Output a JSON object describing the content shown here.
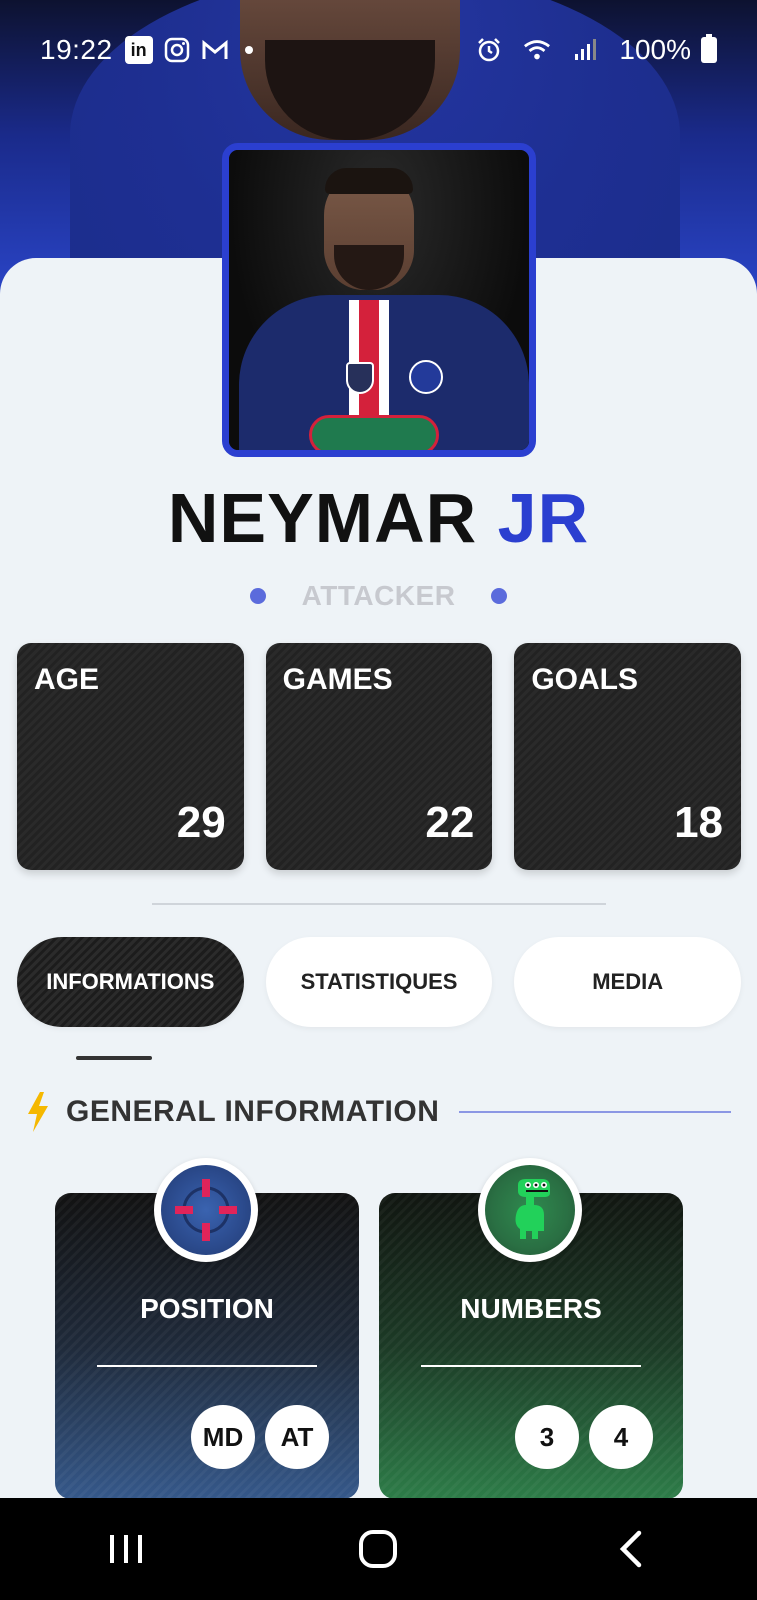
{
  "status_bar": {
    "time": "19:22",
    "battery": "100%",
    "icons": [
      "linkedin-icon",
      "instagram-icon",
      "gmail-icon",
      "alarm-icon",
      "wifi-icon",
      "signal-icon",
      "battery-icon"
    ]
  },
  "player": {
    "first_name": "NEYMAR",
    "last_name": "JR",
    "role": "ATTACKER"
  },
  "stats": [
    {
      "label": "AGE",
      "value": "29"
    },
    {
      "label": "GAMES",
      "value": "22"
    },
    {
      "label": "GOALS",
      "value": "18"
    }
  ],
  "tabs": [
    {
      "label": "INFORMATIONS",
      "active": true
    },
    {
      "label": "STATISTIQUES",
      "active": false
    },
    {
      "label": "MEDIA",
      "active": false
    }
  ],
  "section": {
    "title": "GENERAL INFORMATION"
  },
  "info_cards": {
    "position": {
      "title": "POSITION",
      "chips": [
        "MD",
        "AT"
      ]
    },
    "numbers": {
      "title": "NUMBERS",
      "chips": [
        "3",
        "4"
      ]
    }
  },
  "colors": {
    "accent": "#2b3fd0",
    "bullet": "#5b6bdc",
    "role_text": "#c7c9cf",
    "card_dark": "#222222",
    "position_card_bottom": "#35588a",
    "numbers_card_bottom": "#2d7c48"
  }
}
